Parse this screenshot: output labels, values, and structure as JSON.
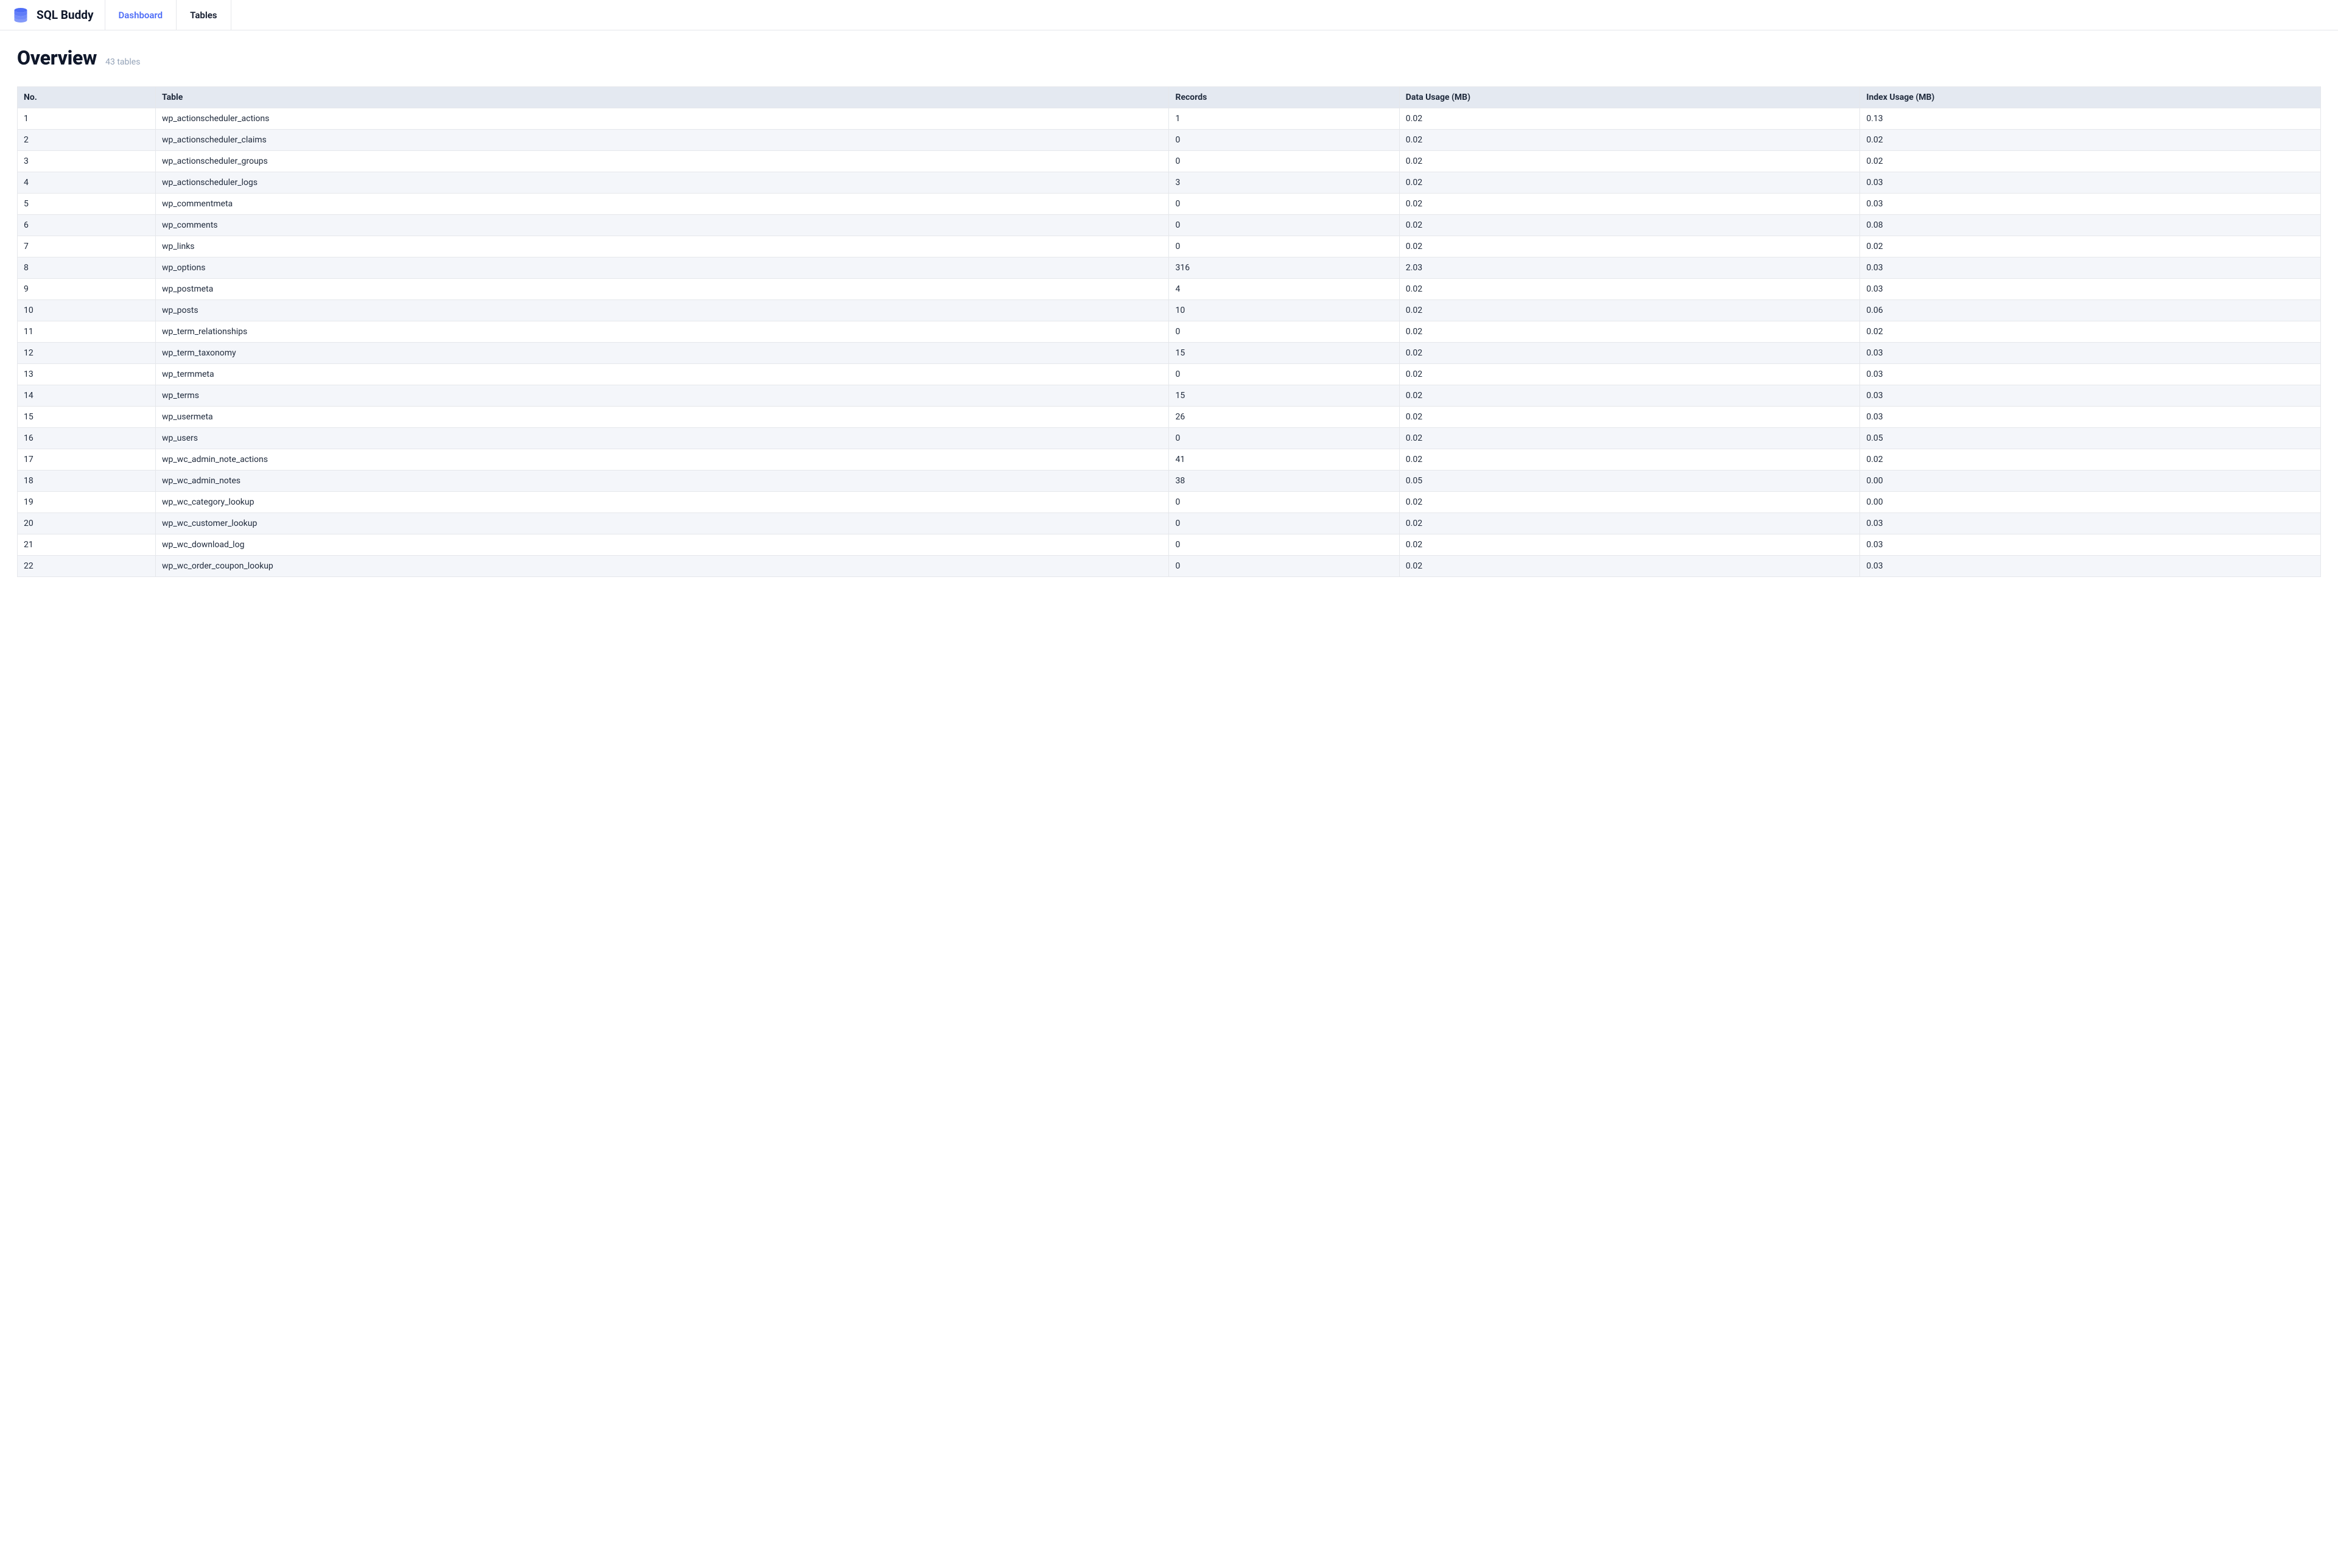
{
  "brand": {
    "name": "SQL Buddy"
  },
  "nav": {
    "tabs": [
      {
        "label": "Dashboard",
        "active": true
      },
      {
        "label": "Tables",
        "active": false
      }
    ]
  },
  "page": {
    "title": "Overview",
    "subtitle": "43 tables"
  },
  "table": {
    "headers": {
      "no": "No.",
      "table": "Table",
      "records": "Records",
      "data": "Data Usage (MB)",
      "index": "Index Usage (MB)"
    },
    "rows": [
      {
        "no": "1",
        "table": "wp_actionscheduler_actions",
        "records": "1",
        "data": "0.02",
        "index": "0.13"
      },
      {
        "no": "2",
        "table": "wp_actionscheduler_claims",
        "records": "0",
        "data": "0.02",
        "index": "0.02"
      },
      {
        "no": "3",
        "table": "wp_actionscheduler_groups",
        "records": "0",
        "data": "0.02",
        "index": "0.02"
      },
      {
        "no": "4",
        "table": "wp_actionscheduler_logs",
        "records": "3",
        "data": "0.02",
        "index": "0.03"
      },
      {
        "no": "5",
        "table": "wp_commentmeta",
        "records": "0",
        "data": "0.02",
        "index": "0.03"
      },
      {
        "no": "6",
        "table": "wp_comments",
        "records": "0",
        "data": "0.02",
        "index": "0.08"
      },
      {
        "no": "7",
        "table": "wp_links",
        "records": "0",
        "data": "0.02",
        "index": "0.02"
      },
      {
        "no": "8",
        "table": "wp_options",
        "records": "316",
        "data": "2.03",
        "index": "0.03"
      },
      {
        "no": "9",
        "table": "wp_postmeta",
        "records": "4",
        "data": "0.02",
        "index": "0.03"
      },
      {
        "no": "10",
        "table": "wp_posts",
        "records": "10",
        "data": "0.02",
        "index": "0.06"
      },
      {
        "no": "11",
        "table": "wp_term_relationships",
        "records": "0",
        "data": "0.02",
        "index": "0.02"
      },
      {
        "no": "12",
        "table": "wp_term_taxonomy",
        "records": "15",
        "data": "0.02",
        "index": "0.03"
      },
      {
        "no": "13",
        "table": "wp_termmeta",
        "records": "0",
        "data": "0.02",
        "index": "0.03"
      },
      {
        "no": "14",
        "table": "wp_terms",
        "records": "15",
        "data": "0.02",
        "index": "0.03"
      },
      {
        "no": "15",
        "table": "wp_usermeta",
        "records": "26",
        "data": "0.02",
        "index": "0.03"
      },
      {
        "no": "16",
        "table": "wp_users",
        "records": "0",
        "data": "0.02",
        "index": "0.05"
      },
      {
        "no": "17",
        "table": "wp_wc_admin_note_actions",
        "records": "41",
        "data": "0.02",
        "index": "0.02"
      },
      {
        "no": "18",
        "table": "wp_wc_admin_notes",
        "records": "38",
        "data": "0.05",
        "index": "0.00"
      },
      {
        "no": "19",
        "table": "wp_wc_category_lookup",
        "records": "0",
        "data": "0.02",
        "index": "0.00"
      },
      {
        "no": "20",
        "table": "wp_wc_customer_lookup",
        "records": "0",
        "data": "0.02",
        "index": "0.03"
      },
      {
        "no": "21",
        "table": "wp_wc_download_log",
        "records": "0",
        "data": "0.02",
        "index": "0.03"
      },
      {
        "no": "22",
        "table": "wp_wc_order_coupon_lookup",
        "records": "0",
        "data": "0.02",
        "index": "0.03"
      }
    ]
  }
}
